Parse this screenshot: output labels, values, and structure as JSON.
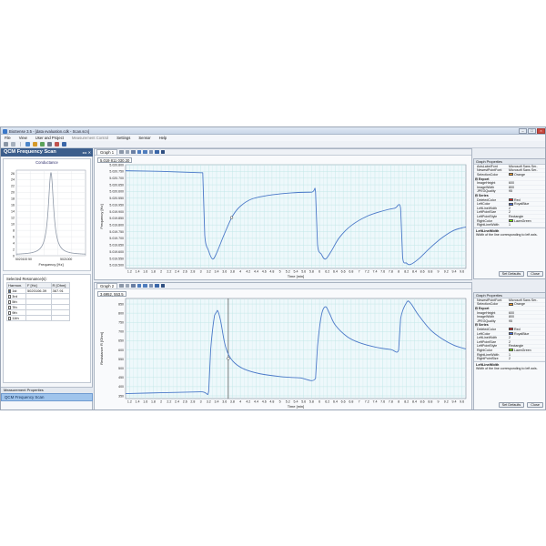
{
  "window": {
    "title": "BioSense 3.5 - [data evaluation.cdk - Scan.scn]"
  },
  "menu": [
    "File",
    "View",
    "User and Project",
    "Measurement Control",
    "Settings",
    "Sensor",
    "Help"
  ],
  "left_panel": {
    "title": "QCM Frequency Scan",
    "controls": "◂ ▸ ✕",
    "conductance_title": "Conductance",
    "conductance_chart": {
      "type": "line",
      "title": "Conductance",
      "xlabel": "Frequency [Hz]",
      "ylabel": "",
      "x_ticks": [
        "5020100 50",
        "5021000"
      ],
      "y_ticks": [
        "26",
        "24",
        "22",
        "20",
        "18",
        "16",
        "14",
        "12",
        "10",
        "8",
        "6",
        "4",
        "2",
        "0"
      ],
      "ylim": [
        0,
        27
      ]
    },
    "selected_resonances_label": "Selected Resonance(s):",
    "table_headers": [
      "Harmon.",
      "F [Hz]",
      "R [Ohm]"
    ],
    "table_rows": [
      {
        "harmonic": "1st",
        "f": "5020106.39",
        "r": "367.91",
        "checked": true
      },
      {
        "harmonic": "3rd",
        "f": "",
        "r": "",
        "checked": false
      },
      {
        "harmonic": "5th",
        "f": "",
        "r": "",
        "checked": false
      },
      {
        "harmonic": "7th",
        "f": "",
        "r": "",
        "checked": false
      },
      {
        "harmonic": "9th",
        "f": "",
        "r": "",
        "checked": false
      },
      {
        "harmonic": "11th",
        "f": "",
        "r": "",
        "checked": false
      }
    ],
    "measurement_properties": "Measurement Properties",
    "qcm_tab": "QCM Frequency Scan"
  },
  "graph1": {
    "tab": "Graph 1",
    "readout": "5.019 811 030.30",
    "chart_data": {
      "type": "line",
      "xlabel": "Time [min]",
      "ylabel": "Frequency [Hz]",
      "y_ticks": [
        "5.020.800",
        "5.020.750",
        "5.020.700",
        "5.020.650",
        "5.020.600",
        "5.020.550",
        "5.019.950",
        "5.019.900",
        "5.019.850",
        "5.019.800",
        "5.019.750",
        "5.019.700",
        "5.019.650",
        "5.019.600",
        "5.019.550",
        "5.019.500"
      ],
      "x_ticks": [
        "1.2",
        "1.4",
        "1.6",
        "1.8",
        "2",
        "2.2",
        "2.4",
        "2.6",
        "2.8",
        "3",
        "3.2",
        "3.4",
        "3.6",
        "3.8",
        "4",
        "4.2",
        "4.4",
        "4.6",
        "4.8",
        "5",
        "5.2",
        "5.4",
        "5.6",
        "5.8",
        "6",
        "6.2",
        "6.4",
        "6.6",
        "6.8",
        "7",
        "7.2",
        "7.4",
        "7.6",
        "7.8",
        "8",
        "8.2",
        "8.4",
        "8.6",
        "8.8",
        "9",
        "9.2",
        "9.4",
        "9.6"
      ],
      "xlim": [
        1.1,
        9.7
      ],
      "ylim": [
        0,
        15.5
      ],
      "series": [
        {
          "points": [
            [
              1.1,
              14.6
            ],
            [
              2.0,
              14.5
            ],
            [
              3.0,
              14.3
            ],
            [
              3.05,
              14.3
            ],
            [
              3.1,
              5.0
            ],
            [
              3.2,
              2.6
            ],
            [
              3.3,
              1.4
            ],
            [
              3.4,
              2.3
            ],
            [
              3.6,
              5.2
            ],
            [
              3.8,
              7.8
            ],
            [
              4.0,
              9.3
            ],
            [
              4.3,
              10.4
            ],
            [
              4.8,
              11.0
            ],
            [
              5.3,
              11.3
            ],
            [
              5.8,
              11.4
            ],
            [
              5.9,
              11.4
            ],
            [
              5.95,
              3.6
            ],
            [
              6.05,
              2.1
            ],
            [
              6.15,
              1.4
            ],
            [
              6.3,
              2.6
            ],
            [
              6.5,
              4.6
            ],
            [
              6.8,
              6.4
            ],
            [
              7.2,
              7.8
            ],
            [
              7.6,
              8.6
            ],
            [
              7.9,
              9.0
            ],
            [
              8.05,
              9.0
            ],
            [
              8.1,
              1.7
            ],
            [
              8.2,
              0.8
            ],
            [
              8.3,
              0.6
            ],
            [
              8.5,
              1.4
            ],
            [
              8.8,
              3.1
            ],
            [
              9.1,
              4.6
            ],
            [
              9.4,
              5.7
            ],
            [
              9.7,
              6.2
            ]
          ]
        }
      ],
      "markers": [
        {
          "x": 3.78,
          "y": 7.6
        }
      ]
    }
  },
  "graph2": {
    "tab": "Graph 2",
    "readout": "3.6952, 553.5",
    "chart_data": {
      "type": "line",
      "xlabel": "Time [min]",
      "ylabel": "Resistance R [Ohm]",
      "y_ticks": [
        "850",
        "800",
        "750",
        "700",
        "650",
        "600",
        "550",
        "500",
        "450",
        "400",
        "350"
      ],
      "x_ticks": [
        "1.2",
        "1.4",
        "1.6",
        "1.8",
        "2",
        "2.2",
        "2.4",
        "2.6",
        "2.8",
        "3",
        "3.2",
        "3.4",
        "3.6",
        "3.8",
        "4",
        "4.2",
        "4.4",
        "4.6",
        "4.8",
        "5",
        "5.2",
        "5.4",
        "5.6",
        "5.8",
        "6",
        "6.2",
        "6.4",
        "6.6",
        "6.8",
        "7",
        "7.2",
        "7.4",
        "7.6",
        "7.8",
        "8",
        "8.2",
        "8.4",
        "8.6",
        "8.8",
        "9",
        "9.2",
        "9.4",
        "9.6"
      ],
      "xlim": [
        1.1,
        9.7
      ],
      "ylim": [
        335,
        880
      ],
      "series": [
        {
          "points": [
            [
              1.1,
              362
            ],
            [
              2.0,
              367
            ],
            [
              3.0,
              372
            ],
            [
              3.2,
              374
            ],
            [
              3.25,
              600
            ],
            [
              3.35,
              790
            ],
            [
              3.42,
              815
            ],
            [
              3.5,
              760
            ],
            [
              3.6,
              640
            ],
            [
              3.7,
              575
            ],
            [
              3.85,
              530
            ],
            [
              4.1,
              495
            ],
            [
              4.5,
              470
            ],
            [
              5.0,
              455
            ],
            [
              5.5,
              448
            ],
            [
              5.9,
              445
            ],
            [
              5.95,
              620
            ],
            [
              6.05,
              790
            ],
            [
              6.15,
              835
            ],
            [
              6.25,
              800
            ],
            [
              6.4,
              735
            ],
            [
              6.7,
              672
            ],
            [
              7.0,
              640
            ],
            [
              7.4,
              616
            ],
            [
              7.8,
              602
            ],
            [
              8.0,
              600
            ],
            [
              8.05,
              770
            ],
            [
              8.2,
              858
            ],
            [
              8.3,
              855
            ],
            [
              8.5,
              790
            ],
            [
              8.8,
              710
            ],
            [
              9.1,
              660
            ],
            [
              9.4,
              625
            ],
            [
              9.7,
              605
            ]
          ]
        }
      ],
      "markers": [
        {
          "x": 3.6952,
          "y": 553.5
        }
      ],
      "cursor_x": 3.6952
    }
  },
  "props1": {
    "title": "Graph Properties",
    "rows": [
      {
        "k": "AxisLabelFont",
        "v": "Microsoft Sans Ser..",
        "type": "row"
      },
      {
        "k": "NewestPointFont",
        "v": "Microsoft Sans Ser..",
        "type": "row"
      },
      {
        "k": "SelectionColor",
        "v": "Orange",
        "type": "swatch",
        "color": "#f59a23"
      },
      {
        "k": "Export",
        "v": "",
        "type": "sec"
      },
      {
        "k": "ImageHeight",
        "v": "600",
        "type": "row"
      },
      {
        "k": "ImageWidth",
        "v": "800",
        "type": "row"
      },
      {
        "k": "JPEGQuality",
        "v": "95",
        "type": "row"
      },
      {
        "k": "Series",
        "v": "",
        "type": "sec"
      },
      {
        "k": "DeletedColor",
        "v": "Red",
        "type": "swatch",
        "color": "#e0201b"
      },
      {
        "k": "LeftColor",
        "v": "RoyalBlue",
        "type": "swatch",
        "color": "#4169e1"
      },
      {
        "k": "LeftLineWidth",
        "v": "2",
        "type": "row"
      },
      {
        "k": "LeftPointSize",
        "v": "2",
        "type": "row"
      },
      {
        "k": "LeftPointStyle",
        "v": "Rectangle",
        "type": "row"
      },
      {
        "k": "RightColor",
        "v": "LawnGreen",
        "type": "swatch",
        "color": "#7cfc00"
      },
      {
        "k": "RightLineWidth",
        "v": "1",
        "type": "row"
      }
    ],
    "desc_title": "LeftLineWidth",
    "desc_text": "Width of the line corresponding to left axis.",
    "set_defaults": "Set Defaults",
    "close": "Close"
  },
  "props2": {
    "title": "Graph Properties",
    "rows": [
      {
        "k": "NewestPointFont",
        "v": "Microsoft Sans Ser..",
        "type": "row"
      },
      {
        "k": "SelectionColor",
        "v": "Orange",
        "type": "swatch",
        "color": "#f59a23"
      },
      {
        "k": "Export",
        "v": "",
        "type": "sec"
      },
      {
        "k": "ImageHeight",
        "v": "600",
        "type": "row"
      },
      {
        "k": "ImageWidth",
        "v": "800",
        "type": "row"
      },
      {
        "k": "JPEGQuality",
        "v": "95",
        "type": "row"
      },
      {
        "k": "Series",
        "v": "",
        "type": "sec"
      },
      {
        "k": "DeletedColor",
        "v": "Red",
        "type": "swatch",
        "color": "#e0201b"
      },
      {
        "k": "LeftColor",
        "v": "RoyalBlue",
        "type": "swatch",
        "color": "#4169e1"
      },
      {
        "k": "LeftLineWidth",
        "v": "2",
        "type": "row"
      },
      {
        "k": "LeftPointSize",
        "v": "2",
        "type": "row"
      },
      {
        "k": "LeftPointStyle",
        "v": "Rectangle",
        "type": "row"
      },
      {
        "k": "RightColor",
        "v": "LawnGreen",
        "type": "swatch",
        "color": "#7cfc00"
      },
      {
        "k": "RightLineWidth",
        "v": "1",
        "type": "row"
      },
      {
        "k": "RightPointSize",
        "v": "2",
        "type": "row"
      }
    ],
    "desc_title": "LeftLineWidth",
    "desc_text": "Width of the line corresponding to left axis.",
    "set_defaults": "Set Defaults",
    "close": "Close"
  },
  "colors": {
    "line": "#4a78c8",
    "grid": "#bfe6e6",
    "plot_bg": "#eef8fb",
    "panel_head": "#3c5e8c"
  }
}
